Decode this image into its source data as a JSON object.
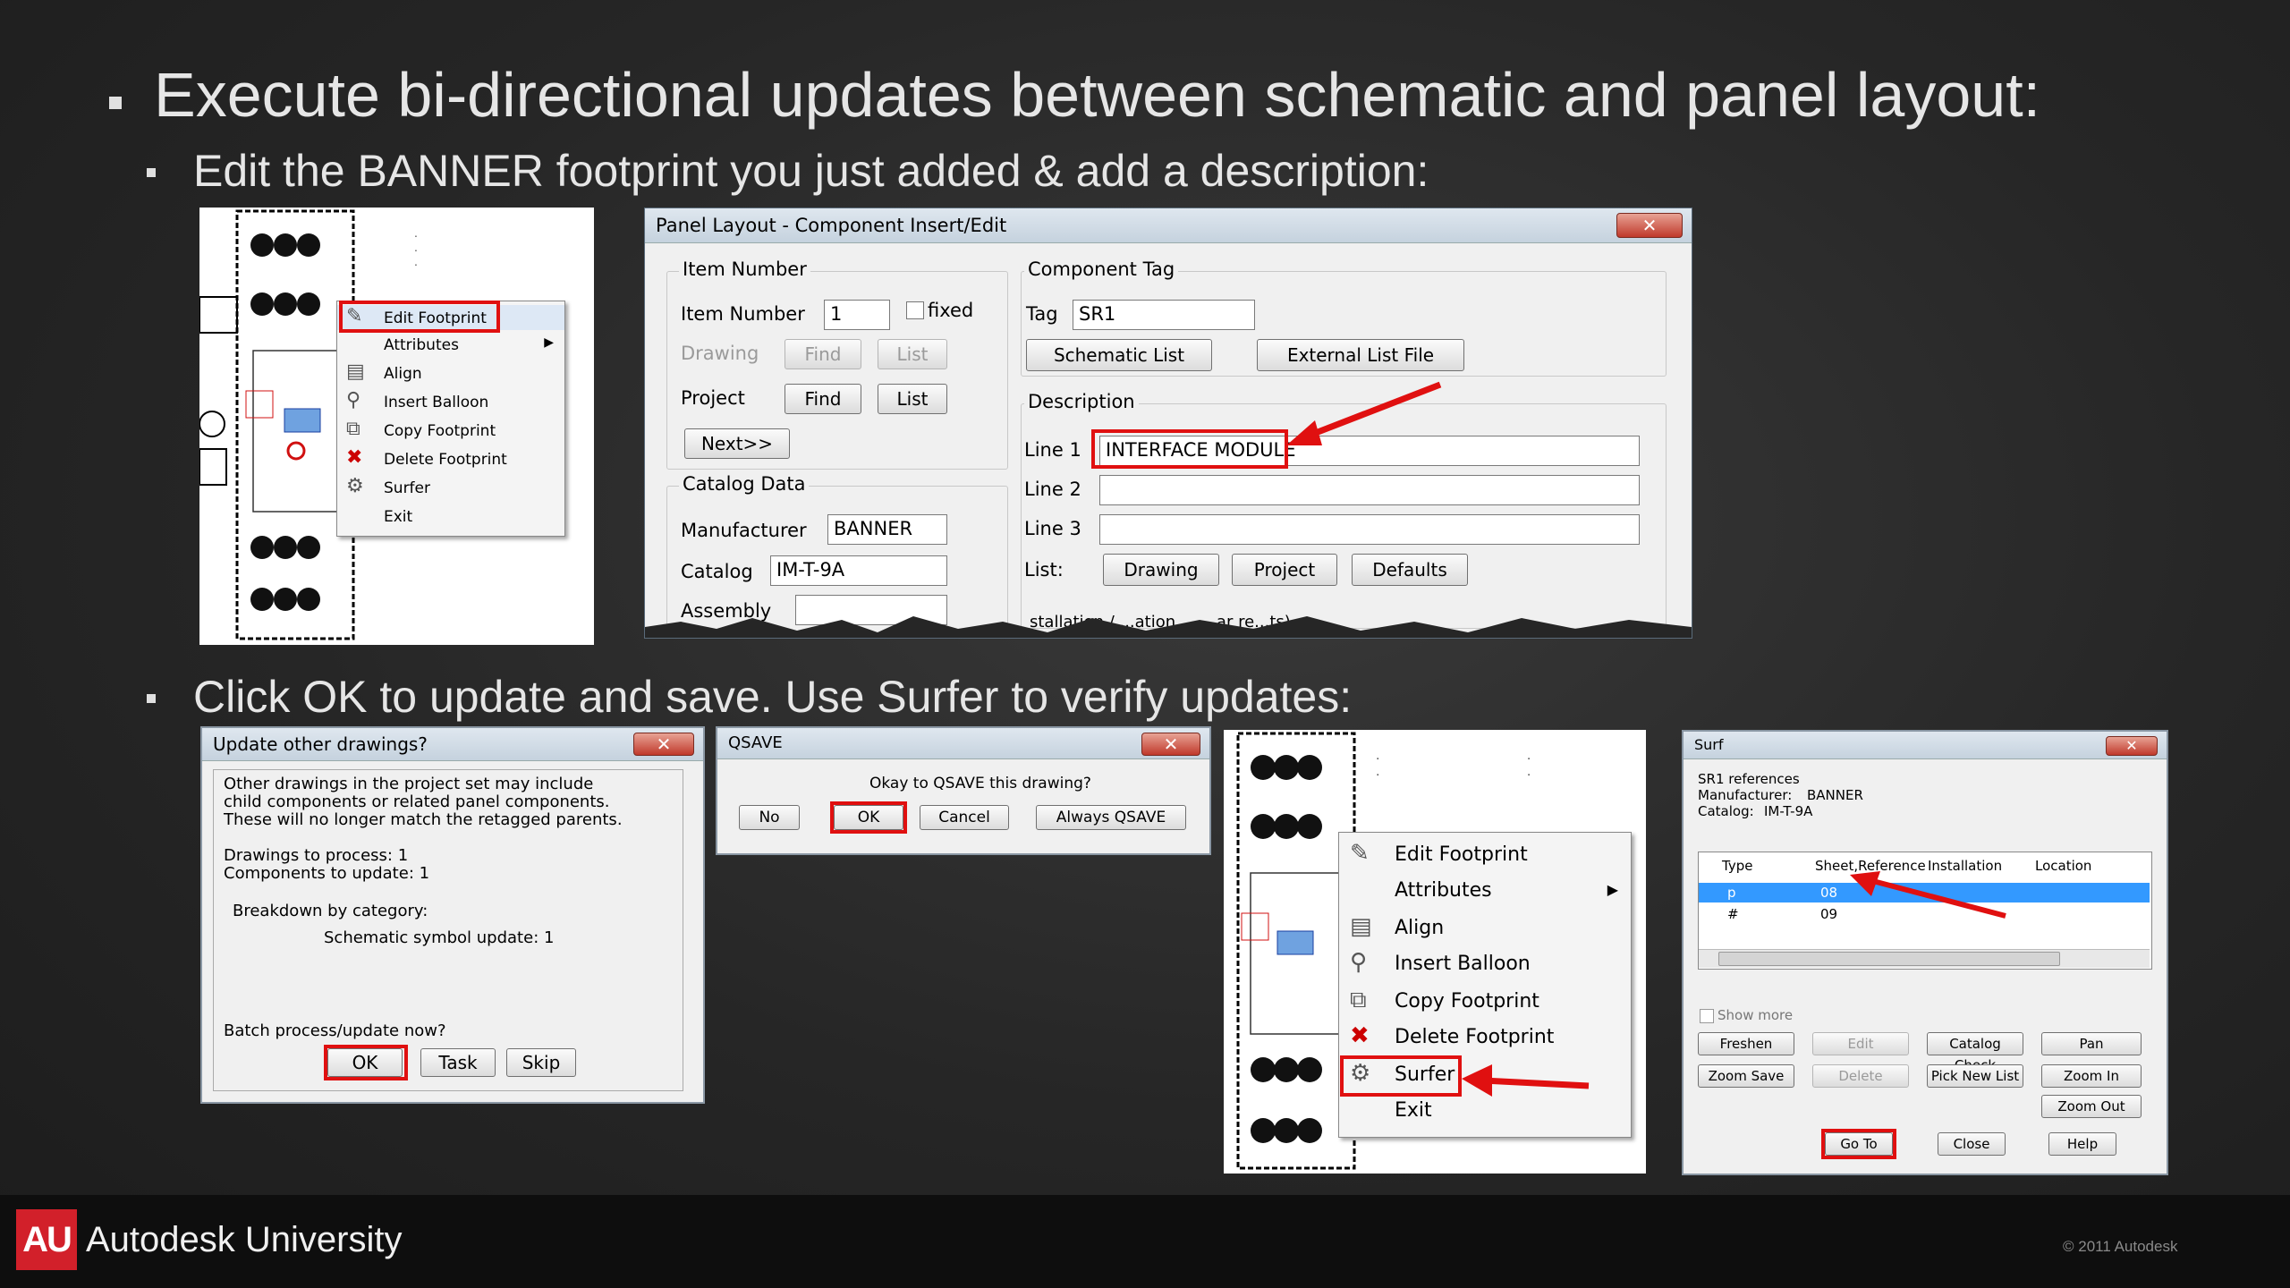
{
  "slide": {
    "heading": "Execute bi-directional updates between schematic and panel layout:",
    "bullet1": "Edit the BANNER footprint you just added & add a description:",
    "bullet2": "Click OK to update and save.  Use Surfer to verify updates:"
  },
  "context_menu": {
    "items": [
      {
        "label": "Edit Footprint",
        "icon": "edit-footprint-icon"
      },
      {
        "label": "Attributes",
        "icon": "",
        "submenu": true
      },
      {
        "label": "Align",
        "icon": "align-icon"
      },
      {
        "label": "Insert Balloon",
        "icon": "insert-balloon-icon"
      },
      {
        "label": "Copy Footprint",
        "icon": "copy-footprint-icon"
      },
      {
        "label": "Delete Footprint",
        "icon": "delete-footprint-icon"
      },
      {
        "label": "Surfer",
        "icon": "surfer-icon"
      },
      {
        "label": "Exit",
        "icon": ""
      }
    ]
  },
  "panel_dialog": {
    "title": "Panel Layout - Component Insert/Edit",
    "item_number_group": "Item Number",
    "item_number_label": "Item Number",
    "item_number_value": "1",
    "fixed_label": "fixed",
    "drawing_label": "Drawing",
    "project_label": "Project",
    "find_label": "Find",
    "list_label": "List",
    "next_label": "Next>>",
    "catalog_group": "Catalog Data",
    "manufacturer_label": "Manufacturer",
    "manufacturer_value": "BANNER",
    "catalog_label": "Catalog",
    "catalog_value": "IM-T-9A",
    "assembly_label": "Assembly",
    "component_tag_group": "Component Tag",
    "tag_label": "Tag",
    "tag_value": "SR1",
    "schematic_list_label": "Schematic List",
    "external_list_label": "External List File",
    "description_group": "Description",
    "line1_label": "Line 1",
    "line1_value": "INTERFACE MODULE",
    "line2_label": "Line 2",
    "line3_label": "Line 3",
    "list_label2": "List:",
    "drawing_btn": "Drawing",
    "project_btn": "Project",
    "defaults_btn": "Defaults",
    "installation_partial": "stallation / ...ation ... ...ar re...ts)"
  },
  "update_dialog": {
    "title": "Update other drawings?",
    "message_lines": [
      "Other drawings in the project set may include",
      "child components or related panel components.",
      "These will no longer match the retagged parents."
    ],
    "drawings_to_process": "Drawings to process: 1",
    "components_to_update": "Components to update: 1",
    "breakdown": "Breakdown by category:",
    "schematic_update": "Schematic symbol update: 1",
    "batch_prompt": "Batch process/update now?",
    "ok": "OK",
    "task": "Task",
    "skip": "Skip"
  },
  "qsave_dialog": {
    "title": "QSAVE",
    "message": "Okay to QSAVE this drawing?",
    "no": "No",
    "ok": "OK",
    "cancel": "Cancel",
    "always": "Always QSAVE"
  },
  "surf_dialog": {
    "title": "Surf",
    "refs": "SR1 references",
    "manufacturer_label": "Manufacturer:",
    "manufacturer_value": "BANNER",
    "catalog_label": "Catalog:",
    "catalog_value": "IM-T-9A",
    "columns": [
      "Type",
      "Sheet,Reference",
      "Installation",
      "Location"
    ],
    "rows": [
      {
        "type": "p",
        "sheet": "08"
      },
      {
        "type": "#",
        "sheet": "09"
      }
    ],
    "show_more": "Show more",
    "freshen": "Freshen",
    "edit": "Edit",
    "catalog_check": "Catalog Check",
    "pan": "Pan",
    "zoom_save": "Zoom Save",
    "delete": "Delete",
    "pick_new_list": "Pick New List",
    "zoom_in": "Zoom In",
    "zoom_out": "Zoom Out",
    "go_to": "Go To",
    "close": "Close",
    "help": "Help"
  },
  "footer": {
    "logo": "AU",
    "brand": "Autodesk University",
    "copyright": "© 2011 Autodesk"
  },
  "colors": {
    "highlight_red": "#e01010",
    "selection_blue": "#3399ff",
    "brand_red": "#d2202a"
  }
}
